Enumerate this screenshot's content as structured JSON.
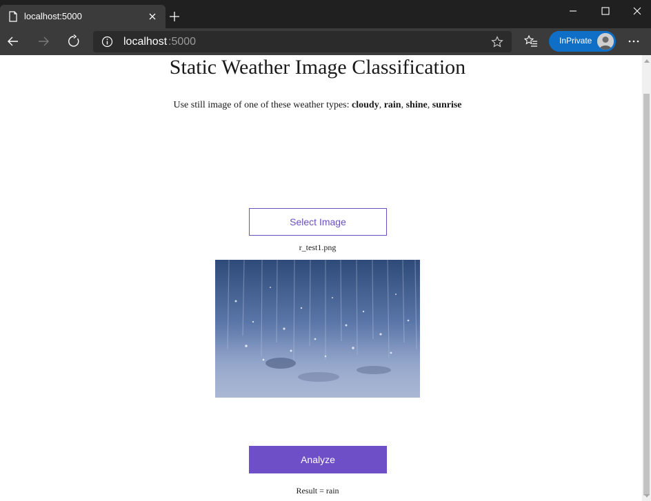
{
  "browser": {
    "tab_title": "localhost:5000",
    "address_host": "localhost",
    "address_port": ":5000",
    "inprivate_label": "InPrivate",
    "accent": "#0f6fc6"
  },
  "page": {
    "title": "Static Weather Image Classification",
    "subtitle_prefix": "Use still image of one of these weather types: ",
    "weather_types": [
      "cloudy",
      "rain",
      "shine",
      "sunrise"
    ],
    "select_button_label": "Select Image",
    "selected_filename": "r_test1.png",
    "analyze_button_label": "Analyze",
    "result_text": "Result = rain",
    "accent": "#6f4fc8"
  }
}
